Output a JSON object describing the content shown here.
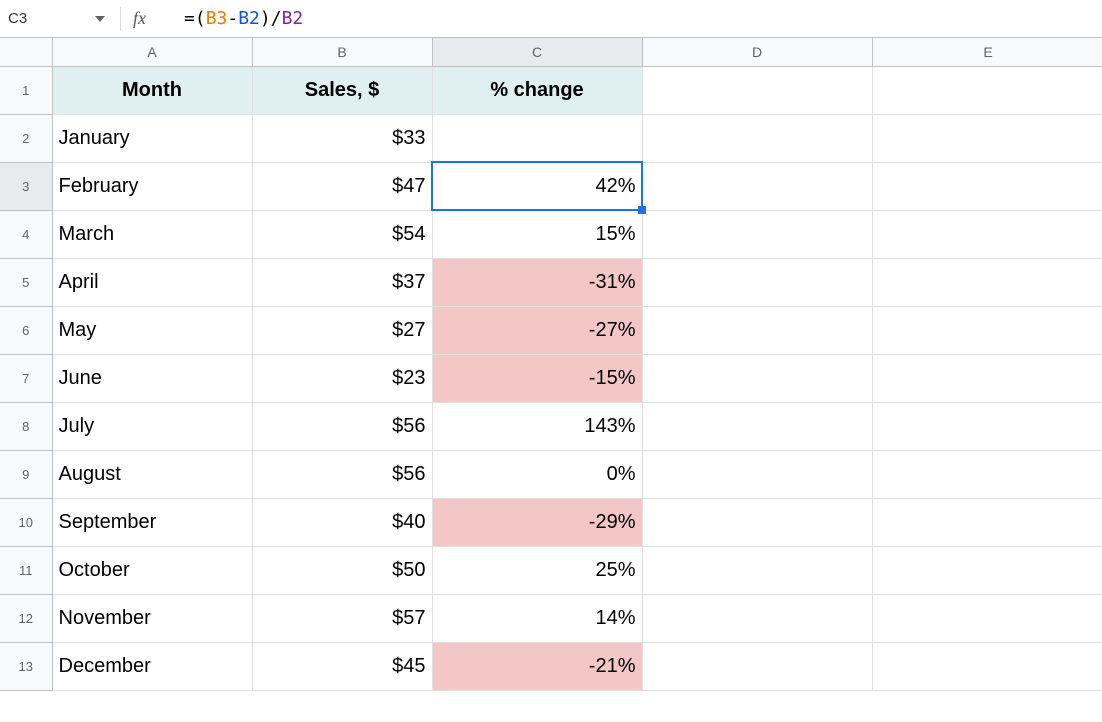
{
  "formula_bar": {
    "cell_ref": "C3",
    "fx_label": "fx",
    "formula_eq": "=",
    "formula_open": "(",
    "formula_ref_b3": "B3",
    "formula_minus": "-",
    "formula_ref_b2a": "B2",
    "formula_close": ")",
    "formula_div": "/",
    "formula_ref_b2b": "B2"
  },
  "columns": {
    "a": "A",
    "b": "B",
    "c": "C",
    "d": "D",
    "e": "E"
  },
  "rows": {
    "r1": "1",
    "r2": "2",
    "r3": "3",
    "r4": "4",
    "r5": "5",
    "r6": "6",
    "r7": "7",
    "r8": "8",
    "r9": "9",
    "r10": "10",
    "r11": "11",
    "r12": "12",
    "r13": "13"
  },
  "headers": {
    "month": "Month",
    "sales": "Sales, $",
    "change": "% change"
  },
  "data": {
    "r2": {
      "month": "January",
      "sales": "$33",
      "change": ""
    },
    "r3": {
      "month": "February",
      "sales": "$47",
      "change": "42%"
    },
    "r4": {
      "month": "March",
      "sales": "$54",
      "change": "15%"
    },
    "r5": {
      "month": "April",
      "sales": "$37",
      "change": "-31%"
    },
    "r6": {
      "month": "May",
      "sales": "$27",
      "change": "-27%"
    },
    "r7": {
      "month": "June",
      "sales": "$23",
      "change": "-15%"
    },
    "r8": {
      "month": "July",
      "sales": "$56",
      "change": "143%"
    },
    "r9": {
      "month": "August",
      "sales": "$56",
      "change": "0%"
    },
    "r10": {
      "month": "September",
      "sales": "$40",
      "change": "-29%"
    },
    "r11": {
      "month": "October",
      "sales": "$50",
      "change": "25%"
    },
    "r12": {
      "month": "November",
      "sales": "$57",
      "change": "14%"
    },
    "r13": {
      "month": "December",
      "sales": "$45",
      "change": "-21%"
    }
  },
  "chart_data": {
    "type": "table",
    "columns": [
      "Month",
      "Sales, $",
      "% change"
    ],
    "rows": [
      [
        "January",
        33,
        null
      ],
      [
        "February",
        47,
        0.42
      ],
      [
        "March",
        54,
        0.15
      ],
      [
        "April",
        37,
        -0.31
      ],
      [
        "May",
        27,
        -0.27
      ],
      [
        "June",
        23,
        -0.15
      ],
      [
        "July",
        56,
        1.43
      ],
      [
        "August",
        56,
        0.0
      ],
      [
        "September",
        40,
        -0.29
      ],
      [
        "October",
        50,
        0.25
      ],
      [
        "November",
        57,
        0.14
      ],
      [
        "December",
        45,
        -0.21
      ]
    ]
  }
}
